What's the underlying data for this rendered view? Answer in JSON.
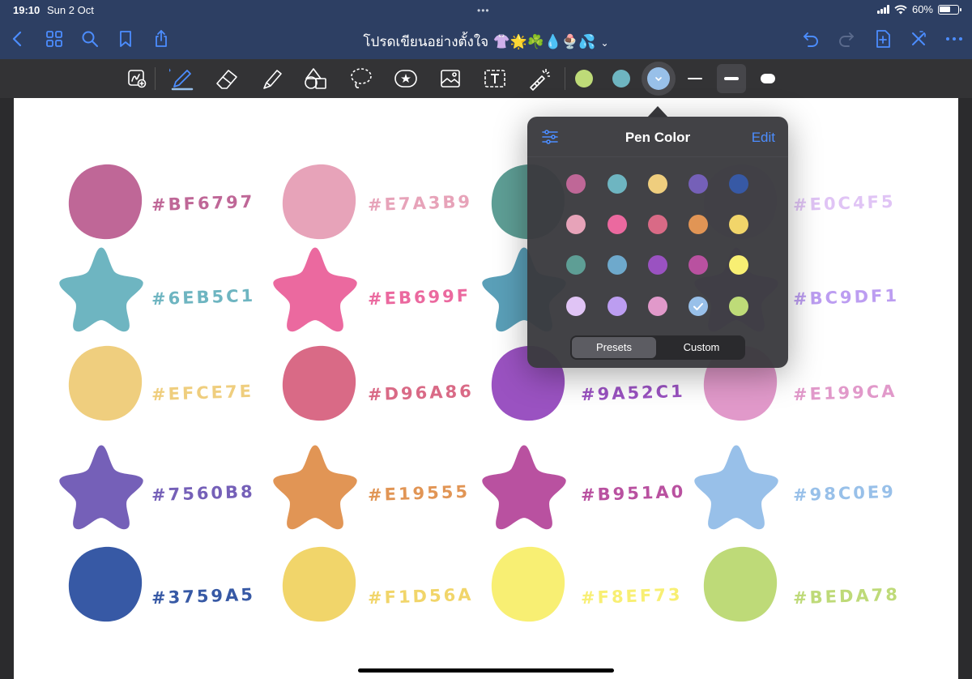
{
  "status_bar": {
    "time": "19:10",
    "date": "Sun 2 Oct",
    "battery_text": "60%",
    "battery_level": 0.6
  },
  "nav": {
    "document_title": "โปรดเขียนอย่างตั้งใจ 👚🌟☘️💧🍨💦",
    "left_icons": [
      "back-chevron-icon",
      "thumbnails-grid-icon",
      "search-icon",
      "bookmark-icon",
      "share-icon"
    ],
    "right_icons": [
      "undo-icon",
      "redo-icon",
      "add-page-icon",
      "close-annotation-icon",
      "more-icon"
    ]
  },
  "toolbar": {
    "tools": [
      "zoom-window-icon",
      "pen-icon",
      "eraser-icon",
      "highlighter-icon",
      "shapes-icon",
      "lasso-icon",
      "sticker-icon",
      "image-icon",
      "text-box-icon",
      "laser-pointer-icon"
    ],
    "active_tool": "pen-icon",
    "colors": [
      "#bedb78",
      "#6eb5c1",
      "#98c0e9"
    ],
    "selected_color": "#98c0e9",
    "widths": [
      "thin",
      "medium",
      "thick"
    ],
    "selected_width": "medium"
  },
  "swatches": [
    {
      "label": "#BF6797",
      "color": "#bf6797",
      "shape": "circle"
    },
    {
      "label": "#E7A3B9",
      "color": "#e7a3b9",
      "shape": "circle"
    },
    {
      "label": "",
      "color": "#5e9e95",
      "shape": "circle"
    },
    {
      "label": "#E0C4F5",
      "color": "#e0c4f5",
      "shape": "circle"
    },
    {
      "label": "#6EB5C1",
      "color": "#6eb5c1",
      "shape": "star"
    },
    {
      "label": "#EB699F",
      "color": "#eb699f",
      "shape": "star"
    },
    {
      "label": "",
      "color": "#5a9fb8",
      "shape": "star"
    },
    {
      "label": "#BC9DF1",
      "color": "#bc9df1",
      "shape": "star"
    },
    {
      "label": "#EFCE7E",
      "color": "#efce7e",
      "shape": "circle"
    },
    {
      "label": "#D96A86",
      "color": "#d96a86",
      "shape": "circle"
    },
    {
      "label": "#9A52C1",
      "color": "#9a52c1",
      "shape": "circle"
    },
    {
      "label": "#E199CA",
      "color": "#e199ca",
      "shape": "circle"
    },
    {
      "label": "#7560B8",
      "color": "#7560b8",
      "shape": "star"
    },
    {
      "label": "#E19555",
      "color": "#e19555",
      "shape": "star"
    },
    {
      "label": "#B951A0",
      "color": "#b951a0",
      "shape": "star"
    },
    {
      "label": "#98C0E9",
      "color": "#98c0e9",
      "shape": "star"
    },
    {
      "label": "#3759A5",
      "color": "#3759a5",
      "shape": "circle"
    },
    {
      "label": "#F1D56A",
      "color": "#f1d56a",
      "shape": "circle"
    },
    {
      "label": "#F8EF73",
      "color": "#f8ef73",
      "shape": "circle"
    },
    {
      "label": "#BEDA78",
      "color": "#beda78",
      "shape": "circle"
    }
  ],
  "pen_color_popover": {
    "title": "Pen Color",
    "edit_label": "Edit",
    "filter_icon": "sliders-icon",
    "colors": [
      "#bf6797",
      "#6eb5c1",
      "#efce7e",
      "#7560b8",
      "#3759a5",
      "#e7a3b9",
      "#eb699f",
      "#d96a86",
      "#e19555",
      "#f1d56a",
      "#5e9e95",
      "#6ea9cc",
      "#9a52c1",
      "#b951a0",
      "#f8ef73",
      "#e0c4f5",
      "#bc9df1",
      "#e199ca",
      "#98c0e9",
      "#bedb78"
    ],
    "selected_index": 18,
    "segments": [
      "Presets",
      "Custom"
    ],
    "active_segment": "Presets"
  }
}
